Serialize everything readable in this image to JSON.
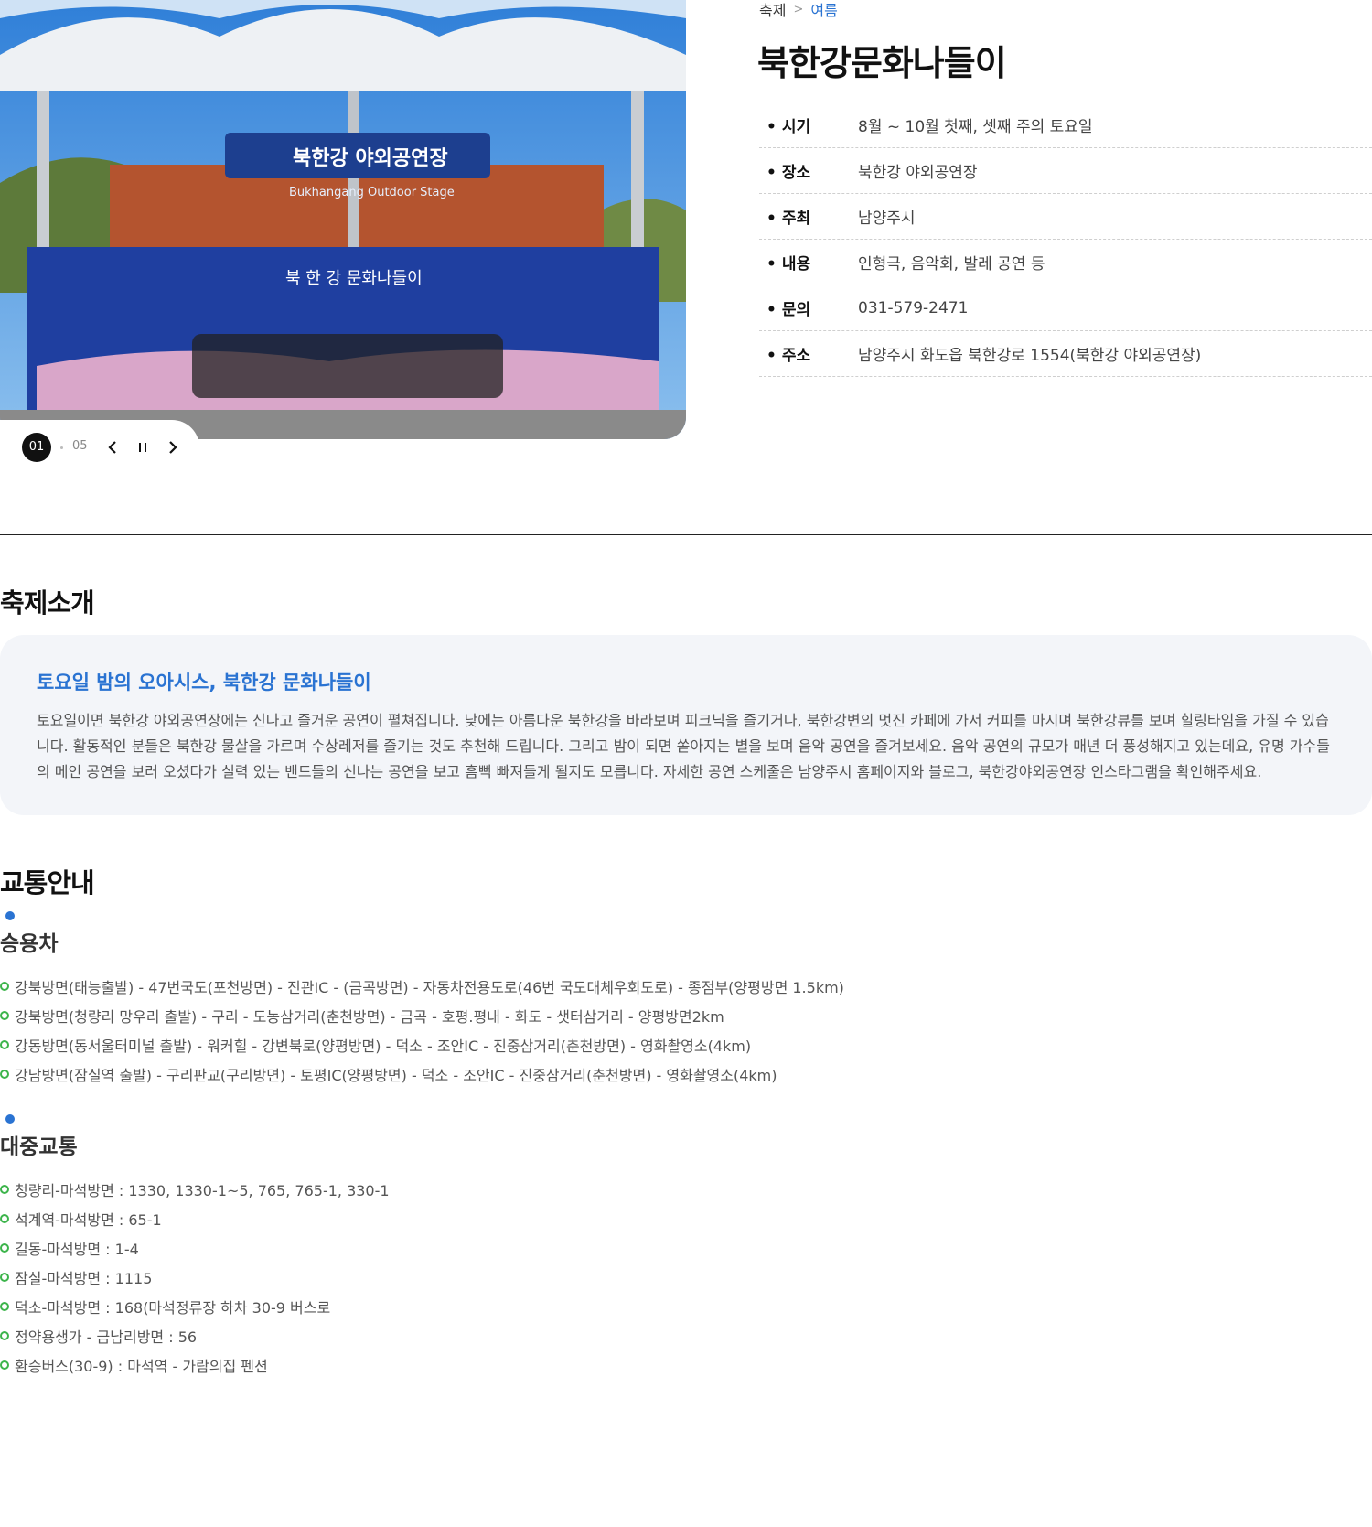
{
  "gallery": {
    "photo_sign_text": "북한강 야외공연장",
    "photo_sign_sub": "Bukhangang Outdoor Stage",
    "photo_banner_text": "북 한 강 문화나들이",
    "current": "01",
    "total": "05"
  },
  "breadcrumb": {
    "home": "축제",
    "current": "여름"
  },
  "title": "북한강문화나들이",
  "info": [
    {
      "label": "시기",
      "value": "8월 ~ 10월 첫째, 셋째 주의 토요일"
    },
    {
      "label": "장소",
      "value": "북한강 야외공연장"
    },
    {
      "label": "주최",
      "value": "남양주시"
    },
    {
      "label": "내용",
      "value": "인형극, 음악회, 발레 공연 등"
    },
    {
      "label": "문의",
      "value": "031-579-2471"
    },
    {
      "label": "주소",
      "value": "남양주시 화도읍 북한강로 1554(북한강 야외공연장)"
    }
  ],
  "intro": {
    "section_title": "축제소개",
    "headline": "토요일 밤의 오아시스, 북한강 문화나들이",
    "body": "토요일이면 북한강 야외공연장에는 신나고 즐거운 공연이 펼쳐집니다. 낮에는 아름다운 북한강을 바라보며 피크닉을 즐기거나, 북한강변의 멋진 카페에 가서 커피를 마시며 북한강뷰를 보며 힐링타임을 가질 수 있습니다. 활동적인 분들은 북한강 물살을 가르며 수상레저를 즐기는 것도 추천해 드립니다. 그리고 밤이 되면 쏟아지는 별을 보며 음악 공연을 즐겨보세요. 음악 공연의 규모가 매년 더 풍성해지고 있는데요, 유명 가수들의 메인 공연을 보러 오셨다가 실력 있는 밴드들의 신나는 공연을 보고 흠뻑 빠져들게 될지도 모릅니다. 자세한 공연 스케줄은 남양주시 홈페이지와 블로그, 북한강야외공연장 인스타그램을 확인해주세요."
  },
  "transport": {
    "section_title": "교통안내",
    "car": {
      "title": "승용차",
      "routes": [
        "강북방면(태능출발) - 47번국도(포천방면) - 진관IC - (금곡방면) - 자동차전용도로(46번 국도대체우회도로) - 종점부(양평방면 1.5km)",
        "강북방면(청량리 망우리 출발) - 구리 - 도농삼거리(춘천방면) - 금곡 - 호평.평내 - 화도 - 샛터삼거리 - 양평방면2km",
        "강동방면(동서울터미널 출발) - 워커힐 - 강변북로(양평방면) - 덕소 - 조안IC - 진중삼거리(춘천방면) - 영화촬영소(4km)",
        "강남방면(잠실역 출발) - 구리판교(구리방면) - 토평IC(양평방면) - 덕소 - 조안IC - 진중삼거리(춘천방면) - 영화촬영소(4km)"
      ]
    },
    "public": {
      "title": "대중교통",
      "routes": [
        "청량리-마석방면 : 1330, 1330-1~5, 765, 765-1, 330-1",
        "석계역-마석방면 : 65-1",
        "길동-마석방면 : 1-4",
        "잠실-마석방면 : 1115",
        "덕소-마석방면 : 168(마석정류장 하차 30-9 버스로",
        "정약용생가 - 금남리방면 : 56",
        "환승버스(30-9) : 마석역 - 가람의집 펜션"
      ]
    }
  },
  "colors": {
    "accent": "#2a73d2",
    "bullet_green": "#3cb44b",
    "intro_bg": "#f3f5f9"
  }
}
